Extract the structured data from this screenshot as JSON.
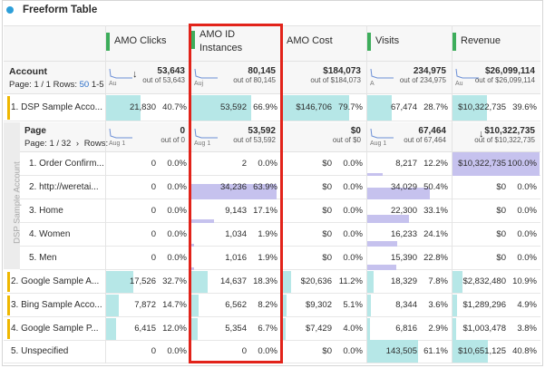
{
  "title": "Freeform Table",
  "columns": [
    {
      "label": "AMO Clicks"
    },
    {
      "label": "AMO ID\nInstances"
    },
    {
      "label": "AMO Cost"
    },
    {
      "label": "Visits"
    },
    {
      "label": "Revenue"
    }
  ],
  "account_header": {
    "label": "Account",
    "page_text": "Page: 1 / 1  Rows:",
    "rows_value": "50",
    "range": "1-5",
    "sort_arrow": "↓",
    "totals": [
      {
        "big": "53,643",
        "sm": "out of 53,643",
        "spark": "Au"
      },
      {
        "big": "80,145",
        "sm": "out of 80,145",
        "spark": "Auj"
      },
      {
        "big": "$184,073",
        "sm": "out of $184,073",
        "spark": ""
      },
      {
        "big": "234,975",
        "sm": "out of 234,975",
        "spark": "A"
      },
      {
        "big": "$26,099,114",
        "sm": "out of $26,099,114",
        "spark": "Au"
      }
    ]
  },
  "account_rows": [
    {
      "label": "1. DSP Sample Acco...",
      "vals": [
        "21,830",
        "40.7%",
        "53,592",
        "66.9%",
        "$146,706",
        "79.7%",
        "67,474",
        "28.7%",
        "$10,322,735",
        "39.6%"
      ],
      "pct": [
        0.41,
        0.67,
        0.8,
        0.29,
        0.4
      ]
    },
    {
      "label": "2. Google Sample A...",
      "vals": [
        "17,526",
        "32.7%",
        "14,637",
        "18.3%",
        "$20,636",
        "11.2%",
        "18,329",
        "7.8%",
        "$2,832,480",
        "10.9%"
      ],
      "pct": [
        0.33,
        0.18,
        0.11,
        0.08,
        0.11
      ]
    },
    {
      "label": "3. Bing Sample Acco...",
      "vals": [
        "7,872",
        "14.7%",
        "6,562",
        "8.2%",
        "$9,302",
        "5.1%",
        "8,344",
        "3.6%",
        "$1,289,296",
        "4.9%"
      ],
      "pct": [
        0.15,
        0.08,
        0.05,
        0.04,
        0.05
      ]
    },
    {
      "label": "4. Google Sample P...",
      "vals": [
        "6,415",
        "12.0%",
        "5,354",
        "6.7%",
        "$7,429",
        "4.0%",
        "6,816",
        "2.9%",
        "$1,003,478",
        "3.8%"
      ],
      "pct": [
        0.12,
        0.07,
        0.04,
        0.03,
        0.04
      ]
    },
    {
      "label": "5. Unspecified",
      "vals": [
        "0",
        "0.0%",
        "0",
        "0.0%",
        "$0",
        "0.0%",
        "143,505",
        "61.1%",
        "$10,651,125",
        "40.8%"
      ],
      "pct": [
        0,
        0,
        0,
        0.61,
        0.41
      ]
    }
  ],
  "page_header": {
    "label": "Page",
    "page_text": "Page: 1 / 32",
    "chevron": "›",
    "rows_label": "Rows:",
    "sort_arrow": "↓",
    "totals": [
      {
        "big": "0",
        "sm": "out of 0",
        "spark": "Aug 1"
      },
      {
        "big": "53,592",
        "sm": "out of 53,592",
        "spark": "Aug 1"
      },
      {
        "big": "$0",
        "sm": "out of $0",
        "spark": ""
      },
      {
        "big": "67,464",
        "sm": "out of 67,464",
        "spark": "Aug 1"
      },
      {
        "big": "$10,322,735",
        "sm": "out of $10,322,735",
        "spark": ""
      }
    ]
  },
  "page_rows": [
    {
      "label": "1. Order Confirm...",
      "vals": [
        "0",
        "0.0%",
        "2",
        "0.0%",
        "$0",
        "0.0%",
        "8,217",
        "12.2%",
        "$10,322,735",
        "100.0%"
      ],
      "pct": [
        0,
        0,
        0,
        0.12,
        1.0
      ]
    },
    {
      "label": "2. http://weretai...",
      "vals": [
        "0",
        "0.0%",
        "34,236",
        "63.9%",
        "$0",
        "0.0%",
        "34,029",
        "50.4%",
        "$0",
        "0.0%"
      ],
      "pct": [
        0,
        0.64,
        0,
        0.5,
        0
      ]
    },
    {
      "label": "3. Home",
      "vals": [
        "0",
        "0.0%",
        "9,143",
        "17.1%",
        "$0",
        "0.0%",
        "22,300",
        "33.1%",
        "$0",
        "0.0%"
      ],
      "pct": [
        0,
        0.17,
        0,
        0.33,
        0
      ]
    },
    {
      "label": "4. Women",
      "vals": [
        "0",
        "0.0%",
        "1,034",
        "1.9%",
        "$0",
        "0.0%",
        "16,233",
        "24.1%",
        "$0",
        "0.0%"
      ],
      "pct": [
        0,
        0.02,
        0,
        0.24,
        0
      ]
    },
    {
      "label": "5. Men",
      "vals": [
        "0",
        "0.0%",
        "1,016",
        "1.9%",
        "$0",
        "0.0%",
        "15,390",
        "22.8%",
        "$0",
        "0.0%"
      ],
      "pct": [
        0,
        0.02,
        0,
        0.23,
        0
      ]
    }
  ],
  "side_label": "DSP Sample Account",
  "colors": {
    "accent_green": "#3dad5b",
    "teal_bar": "#b6e7e7",
    "purple_bar": "#c6c2ee",
    "highlight_red": "#e2231a",
    "yellow": "#efb700",
    "link_blue": "#2a6ec7"
  }
}
